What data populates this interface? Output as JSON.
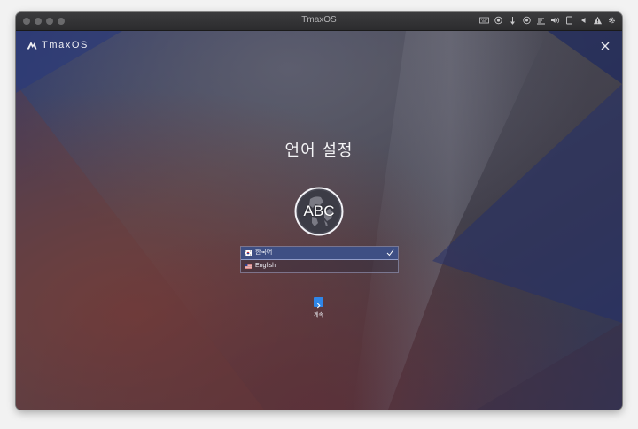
{
  "window": {
    "title": "TmaxOS"
  },
  "status_icons": [
    "keyboard-icon",
    "chip-icon",
    "pen-icon",
    "record-icon",
    "network-icon",
    "volume-icon",
    "tablet-icon",
    "back-triangle-icon",
    "warning-icon",
    "settings-gear-icon"
  ],
  "app": {
    "logo_text": "TmaxOS"
  },
  "setup": {
    "heading": "언어 설정",
    "globe_text": "ABC",
    "languages": [
      {
        "label": "한국어",
        "flag": "korea-flag-icon",
        "selected": true
      },
      {
        "label": "English",
        "flag": "usa-flag-icon",
        "selected": false
      }
    ],
    "continue_label": "계속"
  },
  "colors": {
    "accent": "#2f86e8",
    "selected_row": "#3e4f84"
  }
}
